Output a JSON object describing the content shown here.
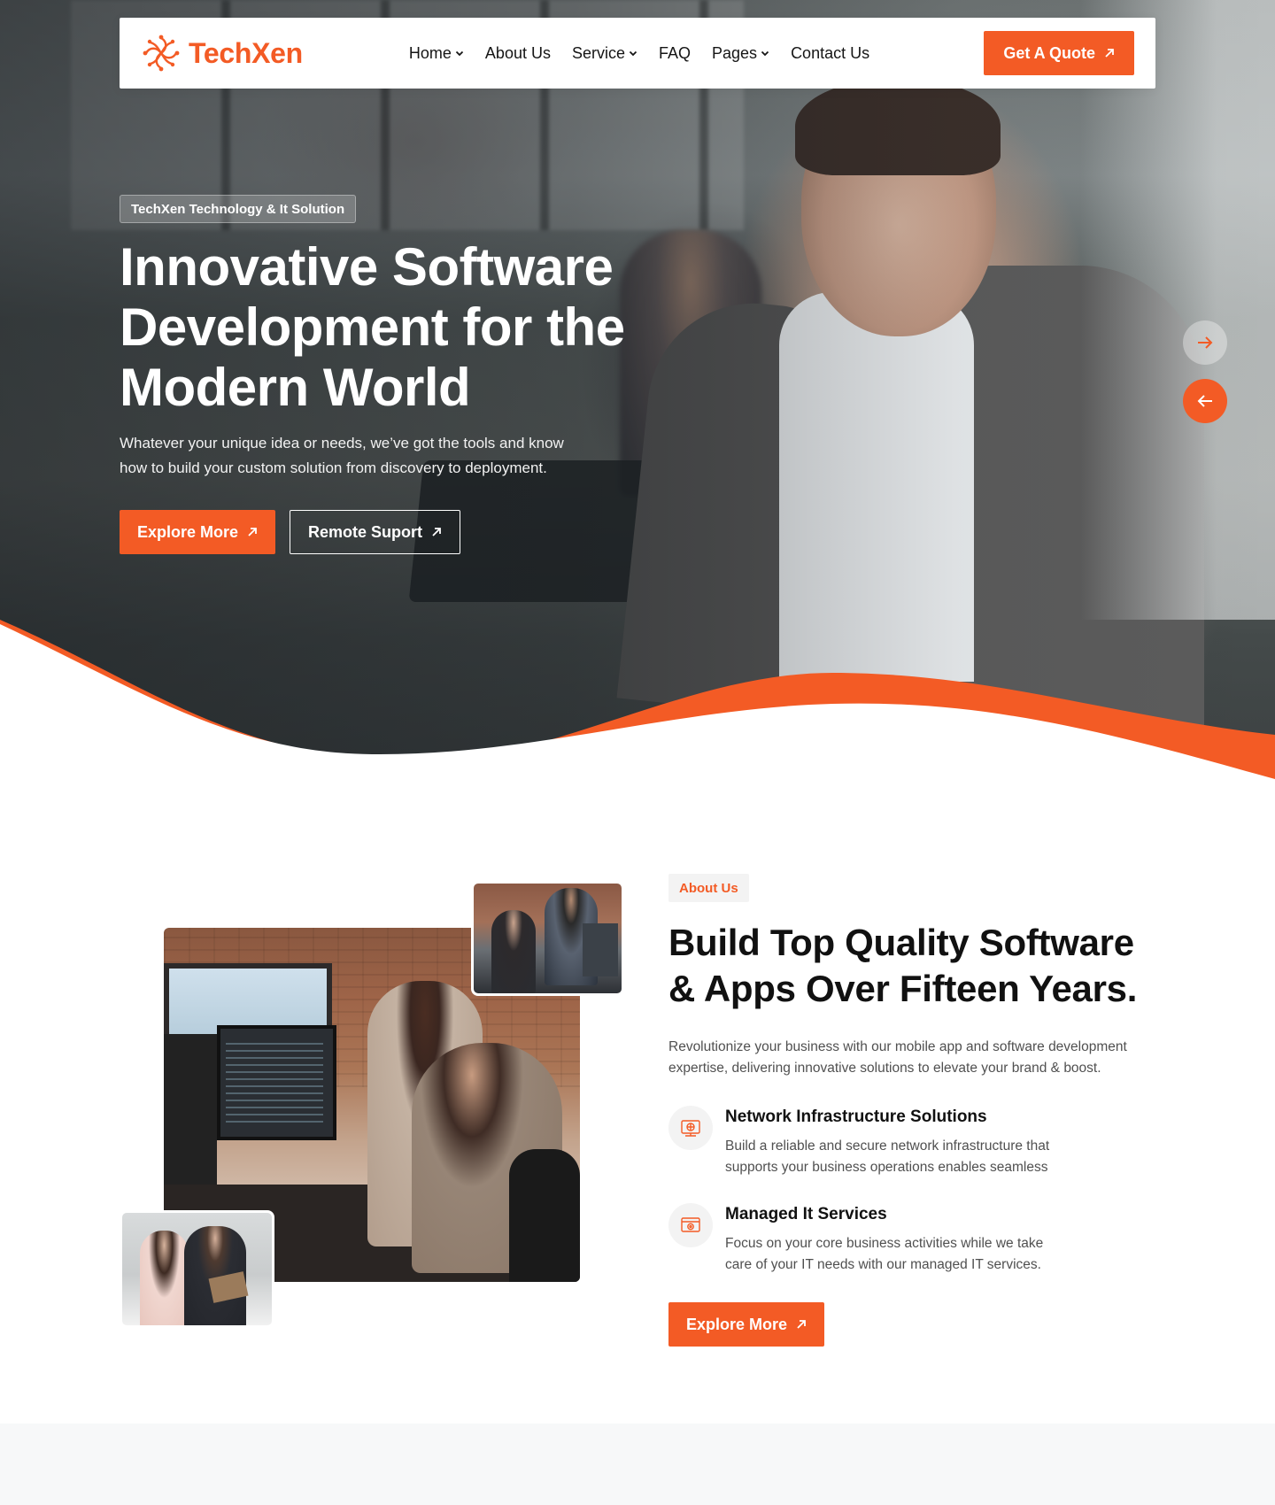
{
  "colors": {
    "accent": "#f35b25",
    "dark": "#111111",
    "muted": "#505050",
    "light_bg": "#f3f3f3"
  },
  "nav": {
    "logo_text": "TechXen",
    "links": [
      {
        "label": "Home",
        "has_dropdown": true
      },
      {
        "label": "About Us",
        "has_dropdown": false
      },
      {
        "label": "Service",
        "has_dropdown": true
      },
      {
        "label": "FAQ",
        "has_dropdown": false
      },
      {
        "label": "Pages",
        "has_dropdown": true
      },
      {
        "label": "Contact Us",
        "has_dropdown": false
      }
    ],
    "cta_label": "Get A Quote",
    "cta_icon": "arrow-up-right-icon"
  },
  "hero": {
    "badge": "TechXen Technology & It Solution",
    "title_lines": [
      "Innovative Software",
      "Development for the",
      "Modern World"
    ],
    "description_lines": [
      "Whatever your unique idea or needs, we’ve got the tools and know",
      "how to build your custom solution from discovery to deployment."
    ],
    "primary_button": "Explore More",
    "secondary_button": "Remote Suport",
    "slider_next_icon": "arrow-right-icon",
    "slider_prev_icon": "arrow-left-icon"
  },
  "about": {
    "badge": "About Us",
    "title_lines": [
      "Build Top Quality Software",
      "& Apps Over Fifteen Years."
    ],
    "description_lines": [
      "Revolutionize your business with our mobile app and software development",
      "expertise, delivering innovative solutions to elevate your brand & boost."
    ],
    "features": [
      {
        "icon": "network-icon",
        "title": "Network Infrastructure Solutions",
        "description_lines": [
          "Build a reliable and secure network infrastructure that",
          "supports your business operations enables seamless"
        ]
      },
      {
        "icon": "managed-it-icon",
        "title": "Managed It Services",
        "description_lines": [
          "Focus on your core business activities while we take",
          "care of your IT needs with our managed IT services."
        ]
      }
    ],
    "button_label": "Explore More"
  }
}
